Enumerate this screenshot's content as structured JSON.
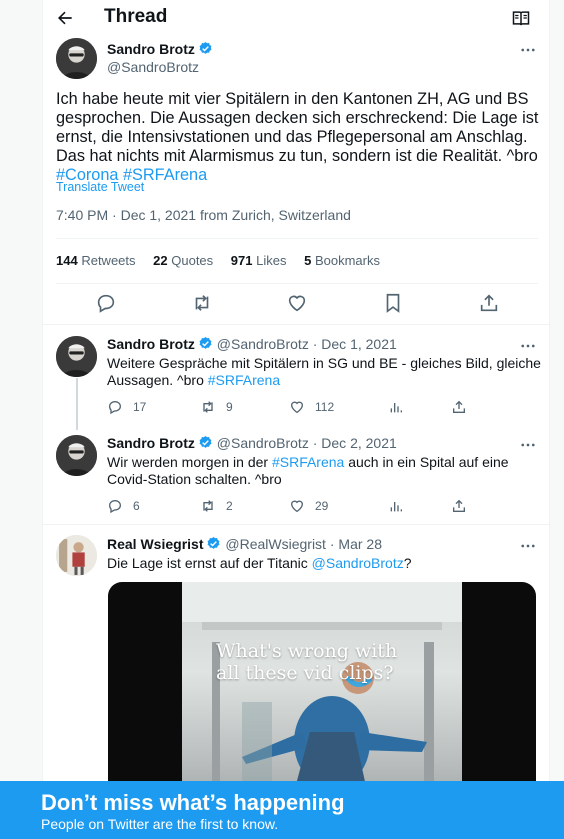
{
  "header": {
    "title": "Thread",
    "back_icon": "arrow-left-icon",
    "reader_icon": "reader-mode-icon"
  },
  "main_tweet": {
    "author_name": "Sandro Brotz",
    "handle": "@SandroBrotz",
    "text_plain": "Ich habe heute mit vier Spitälern in den Kantonen ZH, AG und BS gesprochen. Die Aussagen decken sich erschreckend: Die Lage ist ernst, die Intensivstationen und das Pflegepersonal am Anschlag. Das hat nichts mit Alarmismus zu tun, sondern ist die Realität. ^bro",
    "hashtag_1": "#Corona",
    "hashtag_2": "#SRFArena",
    "translate": "Translate Tweet",
    "meta": "7:40 PM · Dec 1, 2021 from Zurich, Switzerland",
    "stats": {
      "retweets_count": "144",
      "retweets_label": "Retweets",
      "quotes_count": "22",
      "quotes_label": "Quotes",
      "likes_count": "971",
      "likes_label": "Likes",
      "bookmarks_count": "5",
      "bookmarks_label": "Bookmarks"
    }
  },
  "replies": [
    {
      "author_name": "Sandro Brotz",
      "handle": "@SandroBrotz",
      "dot": "·",
      "date": "Dec 1, 2021",
      "text": "Weitere Gespräche mit Spitälern in SG und BE - gleiches Bild, gleiche Aussagen. ^bro",
      "link": "#SRFArena",
      "replies": "17",
      "retweets": "9",
      "likes": "112"
    },
    {
      "author_name": "Sandro Brotz",
      "handle": "@SandroBrotz",
      "dot": "·",
      "date": "Dec 2, 2021",
      "text_before": "Wir werden morgen in der",
      "link": "#SRFArena",
      "text_after": "auch in ein Spital auf eine Covid-Station schalten. ^bro",
      "replies": "6",
      "retweets": "2",
      "likes": "29"
    },
    {
      "author_name": "Real Wsiegrist",
      "handle": "@RealWsiegrist",
      "dot": "·",
      "date": "Mar 28",
      "text_before": "Die Lage ist ernst auf der Titanic",
      "mention": "@SandroBrotz",
      "text_after": "?",
      "media_caption": "What's wrong with all these vid clips?"
    }
  ],
  "banner": {
    "headline": "Don’t miss what’s happening",
    "subtext": "People on Twitter are the first to know."
  },
  "colors": {
    "accent": "#1d9bf0",
    "text": "#0f1419",
    "muted": "#536471"
  }
}
